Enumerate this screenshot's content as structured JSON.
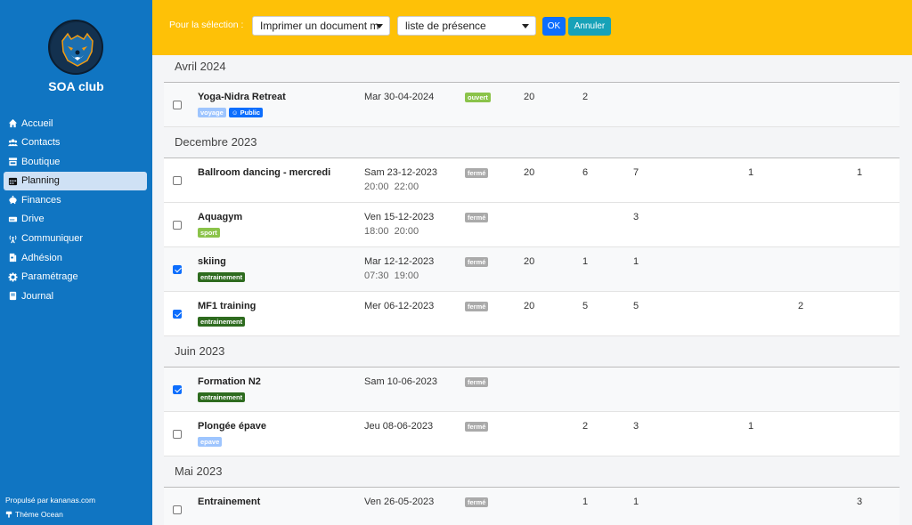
{
  "sidebar": {
    "club_name": "SOA club",
    "items": [
      {
        "label": "Accueil",
        "icon": "home-icon"
      },
      {
        "label": "Contacts",
        "icon": "users-icon"
      },
      {
        "label": "Boutique",
        "icon": "store-icon"
      },
      {
        "label": "Planning",
        "icon": "calendar-icon",
        "active": true
      },
      {
        "label": "Finances",
        "icon": "piggy-bank-icon"
      },
      {
        "label": "Drive",
        "icon": "hdd-icon"
      },
      {
        "label": "Communiquer",
        "icon": "broadcast-icon"
      },
      {
        "label": "Adhésion",
        "icon": "id-card-icon"
      },
      {
        "label": "Paramétrage",
        "icon": "gear-icon"
      },
      {
        "label": "Journal",
        "icon": "book-icon"
      }
    ],
    "powered_by": "Propulsé par kananas.com",
    "theme": "Thème Ocean"
  },
  "topbar": {
    "selection_label": "Pour la sélection :",
    "action_select": "Imprimer un document m",
    "document_select": "liste de présence",
    "ok_label": "OK",
    "cancel_label": "Annuler"
  },
  "colors": {
    "sidebar": "#1075c2",
    "header": "#fec107",
    "tag_voyage": "#9ec5fe",
    "tag_public": "#0d6efd",
    "tag_sport": "#8bc34a",
    "tag_entrainement": "#2e6b1f",
    "tag_epave": "#9ec5fe",
    "status_ouvert": "#8bc34a",
    "status_ferme": "#aaaaaa"
  },
  "groups": [
    {
      "title": "Avril 2024",
      "events": [
        {
          "name": "Yoga-Nidra Retreat",
          "checked": false,
          "tags": [
            {
              "label": "voyage",
              "type": "voyage"
            },
            {
              "label": "☺ Public",
              "type": "public"
            }
          ],
          "date": "Mar 30-04-2024",
          "time": "",
          "status": "ouvert",
          "c1": "20",
          "c2": "2",
          "c3": "",
          "c4": "",
          "c5": "",
          "c6": ""
        }
      ]
    },
    {
      "title": "Decembre 2023",
      "events": [
        {
          "name": "Ballroom dancing - mercredi",
          "checked": false,
          "tags": [],
          "date": "Sam 23-12-2023",
          "time": "20:00  22:00",
          "status": "fermé",
          "c1": "20",
          "c2": "6",
          "c3": "7",
          "c4": "1",
          "c5": "",
          "c6": "1"
        },
        {
          "name": "Aquagym",
          "checked": false,
          "tags": [
            {
              "label": "sport",
              "type": "sport"
            }
          ],
          "date": "Ven 15-12-2023",
          "time": "18:00  20:00",
          "status": "fermé",
          "c1": "",
          "c2": "",
          "c3": "3",
          "c4": "",
          "c5": "",
          "c6": ""
        },
        {
          "name": "skiing",
          "checked": true,
          "tags": [
            {
              "label": "entrainement",
              "type": "entrainement"
            }
          ],
          "date": "Mar 12-12-2023",
          "time": "07:30  19:00",
          "status": "fermé",
          "c1": "20",
          "c2": "1",
          "c3": "1",
          "c4": "",
          "c5": "",
          "c6": ""
        },
        {
          "name": "MF1 training",
          "checked": true,
          "tags": [
            {
              "label": "entrainement",
              "type": "entrainement"
            }
          ],
          "date": "Mer 06-12-2023",
          "time": "",
          "status": "fermé",
          "c1": "20",
          "c2": "5",
          "c3": "5",
          "c4": "",
          "c5": "2",
          "c6": ""
        }
      ]
    },
    {
      "title": "Juin 2023",
      "events": [
        {
          "name": "Formation N2",
          "checked": true,
          "tags": [
            {
              "label": "entrainement",
              "type": "entrainement"
            }
          ],
          "date": "Sam 10-06-2023",
          "time": "",
          "status": "fermé",
          "c1": "",
          "c2": "",
          "c3": "",
          "c4": "",
          "c5": "",
          "c6": ""
        },
        {
          "name": "Plongée épave",
          "checked": false,
          "tags": [
            {
              "label": "epave",
              "type": "epave"
            }
          ],
          "date": "Jeu 08-06-2023",
          "time": "",
          "status": "fermé",
          "c1": "",
          "c2": "2",
          "c3": "3",
          "c4": "1",
          "c5": "",
          "c6": ""
        }
      ]
    },
    {
      "title": "Mai 2023",
      "events": [
        {
          "name": "Entrainement",
          "checked": false,
          "tags": [],
          "date": "Ven 26-05-2023",
          "time": "",
          "status": "fermé",
          "c1": "",
          "c2": "1",
          "c3": "1",
          "c4": "",
          "c5": "",
          "c6": "3"
        }
      ]
    }
  ]
}
